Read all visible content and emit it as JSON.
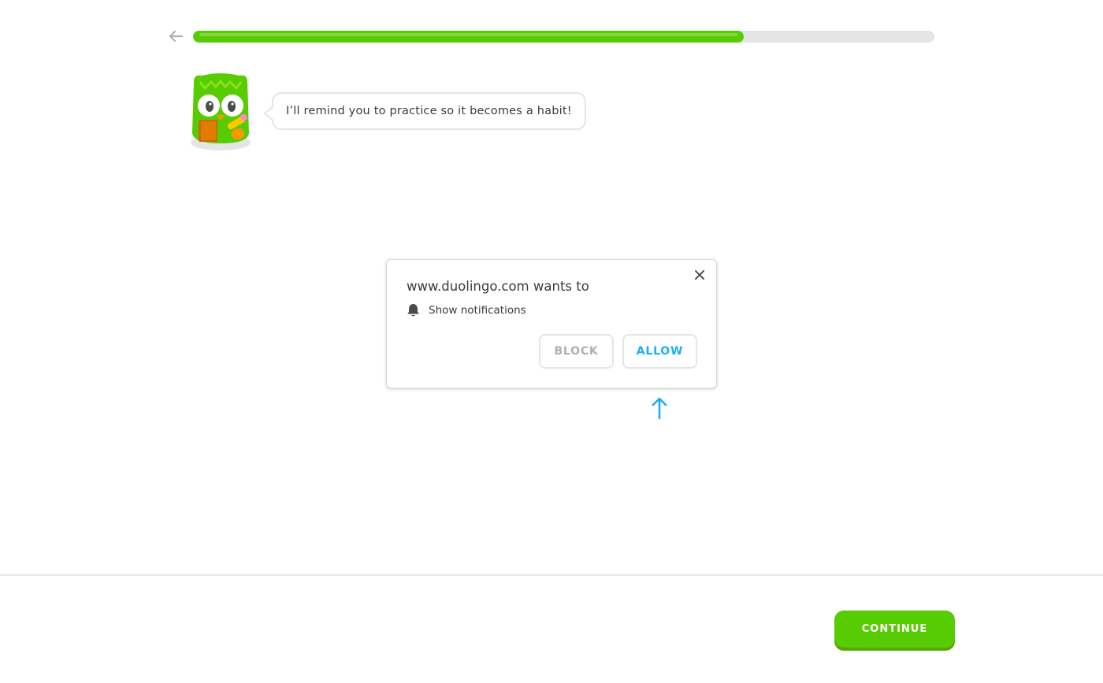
{
  "header": {
    "back_icon": "arrow-left-icon",
    "progress": 0.743
  },
  "lesson": {
    "speech_text": "I’ll remind you to practice so it becomes a habit!"
  },
  "permission_dialog": {
    "title": "www.duolingo.com wants to",
    "permission_icon": "bell-icon",
    "permission_label": "Show notifications",
    "block_label": "BLOCK",
    "allow_label": "ALLOW",
    "close_icon": "close-icon"
  },
  "hint_arrow_icon": "arrow-up-icon",
  "footer": {
    "continue_label": "CONTINUE"
  },
  "colors": {
    "accent_green": "#58cc02",
    "accent_green_shadow": "#58a700",
    "allow_blue": "#1cb0f6",
    "track_gray": "#e5e5e5"
  }
}
